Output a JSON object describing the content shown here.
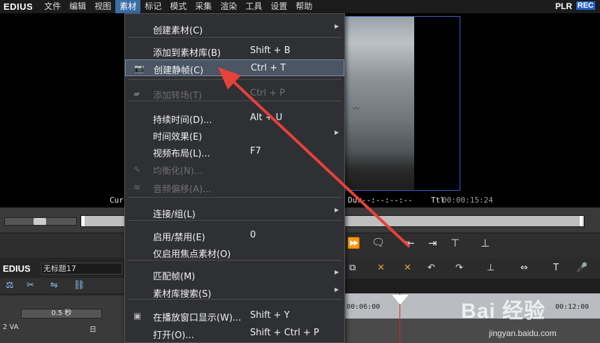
{
  "menubar": {
    "brand": "EDIUS",
    "items": [
      "文件",
      "编辑",
      "视图",
      "素材",
      "标记",
      "模式",
      "采集",
      "渲染",
      "工具",
      "设置",
      "帮助"
    ],
    "plr": "PLR",
    "rec": "REC"
  },
  "player": {
    "cur_label": "Cur",
    "dur_label": "Dur--:--:--:--",
    "ttl_label": "Ttl",
    "ttl_value": "00:00:15:24"
  },
  "dropdown": {
    "items": [
      {
        "label": "创建素材(C)",
        "shortcut": "",
        "submenu": true,
        "enabled": true,
        "icon": ""
      },
      {
        "label": "添加到素材库(B)",
        "shortcut": "Shift + B",
        "submenu": false,
        "enabled": true,
        "icon": ""
      },
      {
        "label": "创建静帧(C)",
        "shortcut": "Ctrl + T",
        "submenu": false,
        "enabled": true,
        "icon": "camera-icon"
      },
      {
        "label": "添加转场(T)",
        "shortcut": "Ctrl + P",
        "submenu": false,
        "enabled": false,
        "icon": "transition-icon"
      },
      {
        "label": "持续时间(D)...",
        "shortcut": "Alt + U",
        "submenu": false,
        "enabled": true,
        "icon": ""
      },
      {
        "label": "时间效果(E)",
        "shortcut": "",
        "submenu": true,
        "enabled": true,
        "icon": ""
      },
      {
        "label": "视频布局(L)...",
        "shortcut": "F7",
        "submenu": false,
        "enabled": true,
        "icon": ""
      },
      {
        "label": "均衡化(N)...",
        "shortcut": "",
        "submenu": false,
        "enabled": false,
        "icon": "waveform-icon"
      },
      {
        "label": "音频偏移(A)...",
        "shortcut": "",
        "submenu": false,
        "enabled": false,
        "icon": "audio-offset-icon"
      },
      {
        "label": "连接/组(L)",
        "shortcut": "",
        "submenu": true,
        "enabled": true,
        "icon": ""
      },
      {
        "label": "启用/禁用(E)",
        "shortcut": "0",
        "submenu": false,
        "enabled": true,
        "icon": ""
      },
      {
        "label": "仅启用焦点素材(O)",
        "shortcut": "",
        "submenu": false,
        "enabled": true,
        "icon": ""
      },
      {
        "label": "匹配帧(M)",
        "shortcut": "",
        "submenu": true,
        "enabled": true,
        "icon": ""
      },
      {
        "label": "素材库搜索(S)",
        "shortcut": "",
        "submenu": true,
        "enabled": true,
        "icon": ""
      },
      {
        "label": "在播放窗口显示(W)...",
        "shortcut": "Shift + Y",
        "submenu": false,
        "enabled": true,
        "icon": "monitor-icon"
      },
      {
        "label": "打开(O)...",
        "shortcut": "Shift + Ctrl + P",
        "submenu": false,
        "enabled": true,
        "icon": ""
      }
    ]
  },
  "timeline": {
    "brand": "EDIUS",
    "project_name": "无标题17",
    "zoom": "0.5 秒",
    "track_label": "2 VA",
    "track_day": "日",
    "ruler_left": "00:06:00",
    "ruler_right": "00:12:00"
  },
  "watermark": {
    "text": "Bai 经验",
    "url": "jingyan.baidu.com"
  },
  "colors": {
    "accent": "#3a6ea5",
    "arrow": "#e8413a",
    "rec": "#1f5fd1"
  }
}
